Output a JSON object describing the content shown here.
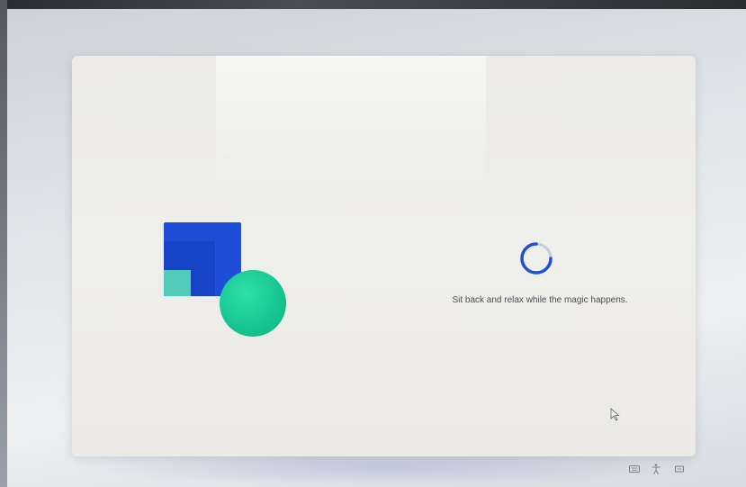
{
  "setup": {
    "status_message": "Sit back and relax while the magic happens."
  },
  "colors": {
    "accent_blue": "#1f4fd8",
    "accent_teal": "#52cbbb",
    "accent_green": "#16c48f",
    "spinner": "#1f4fd8"
  },
  "system_tray": {
    "icons": [
      "keyboard-icon",
      "accessibility-icon",
      "network-icon"
    ]
  }
}
